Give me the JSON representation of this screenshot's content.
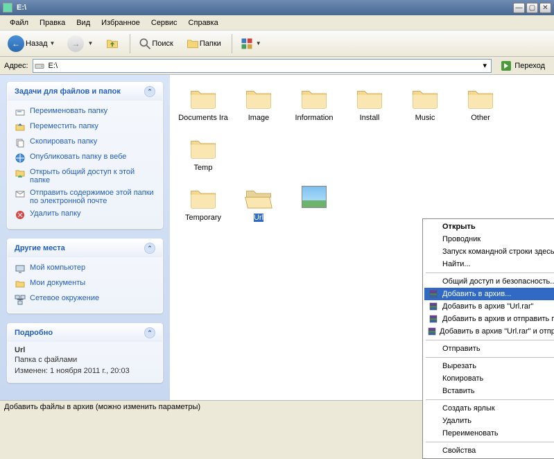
{
  "window": {
    "title": "E:\\"
  },
  "menu": {
    "file": "Файл",
    "edit": "Правка",
    "view": "Вид",
    "favorites": "Избранное",
    "tools": "Сервис",
    "help": "Справка"
  },
  "toolbar": {
    "back": "Назад",
    "search": "Поиск",
    "folders": "Папки"
  },
  "address": {
    "label": "Адрес:",
    "value": "E:\\",
    "go": "Переход"
  },
  "sidebar": {
    "tasks_header": "Задачи для файлов и папок",
    "tasks": [
      "Переименовать папку",
      "Переместить папку",
      "Скопировать папку",
      "Опубликовать папку в вебе",
      "Открыть общий доступ к этой папке",
      "Отправить содержимое этой папки по электронной почте",
      "Удалить папку"
    ],
    "places_header": "Другие места",
    "places": [
      "Мой компьютер",
      "Мои документы",
      "Сетевое окружение"
    ],
    "details_header": "Подробно",
    "details": {
      "name": "Url",
      "type": "Папка с файлами",
      "modified": "Изменен: 1 ноября 2011 г., 20:03"
    }
  },
  "files": {
    "row1": [
      "Documents Ira",
      "Image",
      "Information",
      "Install",
      "Music",
      "Other",
      "Temp"
    ],
    "row2": [
      "Temporary",
      "Url"
    ],
    "image_item": ""
  },
  "context": {
    "open": "Открыть",
    "explorer": "Проводник",
    "cmd": "Запуск командной строки здесь",
    "find": "Найти...",
    "share": "Общий доступ и безопасность...",
    "add_archive": "Добавить в архив...",
    "add_url": "Добавить в архив \"Url.rar\"",
    "add_email": "Добавить в архив и отправить по e-mail...",
    "add_url_email": "Добавить в архив \"Url.rar\" и отправить по e-mail",
    "send": "Отправить",
    "cut": "Вырезать",
    "copy": "Копировать",
    "paste": "Вставить",
    "shortcut": "Создать ярлык",
    "delete": "Удалить",
    "rename": "Переименовать",
    "properties": "Свойства"
  },
  "status": "Добавить файлы в архив (можно изменить параметры)"
}
